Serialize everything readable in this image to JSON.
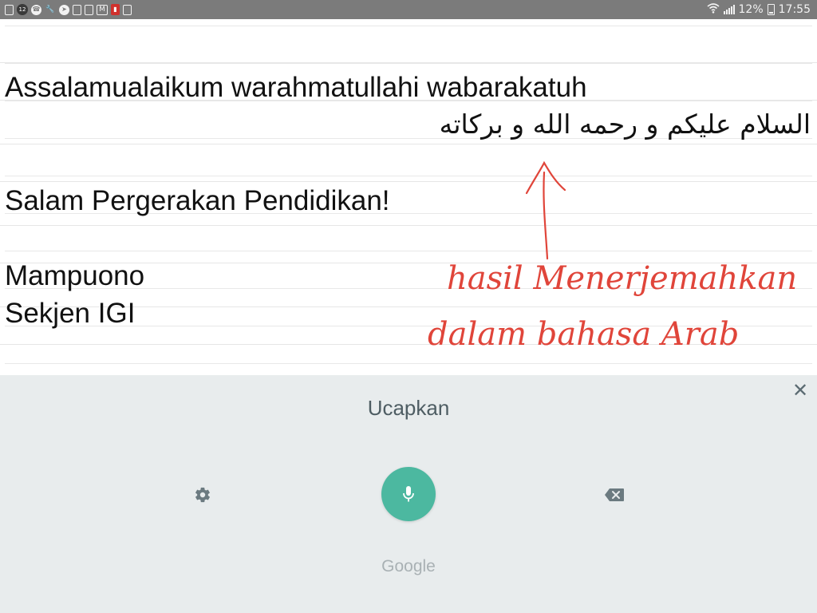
{
  "status_bar": {
    "notification_icons": [
      "sim-icon",
      "notification-count-icon",
      "whatsapp-icon",
      "wrench-icon",
      "telegram-icon",
      "gallery-icon",
      "clipboard-icon",
      "gmail-icon",
      "red-app-icon",
      "image-icon"
    ],
    "notification_count": "12",
    "battery_percent": "12%",
    "time": "17:55"
  },
  "note": {
    "lines": [
      "Assalamualaikum warahmatullahi wabarakatuh",
      "Salam Pergerakan Pendidikan!",
      "Mampuono",
      "Sekjen IGI"
    ],
    "arabic_line": "السلام عليكم و رحمه الله و بركاته",
    "handwriting": {
      "line1": "hasil Menerjemahkan",
      "line2": "dalam bahasa Arab",
      "color": "#e0453a"
    }
  },
  "voice_input": {
    "prompt": "Ucapkan",
    "brand": "Google",
    "accent_color": "#4cb8a0",
    "icons": {
      "close": "close-icon",
      "settings": "gear-icon",
      "mic": "microphone-icon",
      "backspace": "backspace-icon"
    }
  }
}
